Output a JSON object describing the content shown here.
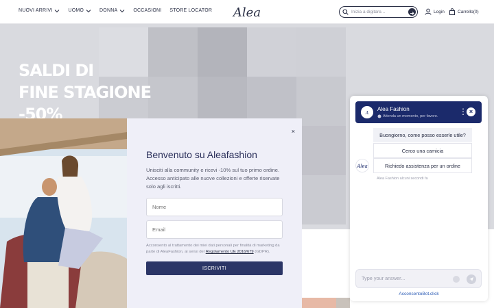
{
  "header": {
    "nav": [
      {
        "label": "NUOVI ARRIVI",
        "has_dropdown": true
      },
      {
        "label": "UOMO",
        "has_dropdown": true
      },
      {
        "label": "DONNA",
        "has_dropdown": true
      },
      {
        "label": "OCCASIONI",
        "has_dropdown": false
      },
      {
        "label": "STORE LOCATOR",
        "has_dropdown": false
      }
    ],
    "logo_text": "Alea",
    "search_placeholder": "Inizia a digitare...",
    "login_label": "Login",
    "cart_label": "Carrello(0)"
  },
  "hero": {
    "line1": "SALDI DI",
    "line2": "FINE STAGIONE",
    "line3": "-50%"
  },
  "modal": {
    "close": "×",
    "title": "Benvenuto su Aleafashion",
    "text": "Unisciti alla community e ricevi -10% sul tuo primo ordine. Accesso anticipato alle nuove collezioni e offerte riservate solo agli iscritti.",
    "name_placeholder": "Nome",
    "email_placeholder": "Email",
    "consent_prefix": "Acconsento al trattamento dei miei dati personali per finalità di marketing da parte di AleaFashion, ai sensi del",
    "consent_link": "Regolamento UE 2016/679",
    "consent_suffix": "(GDPR).",
    "subscribe_label": "ISCRIVITI"
  },
  "chat": {
    "name": "Alea Fashion",
    "status": "Attenda un momento, per favore.",
    "greeting": "Buongiorno, come posso esserle utile?",
    "options": [
      "Cerco una camicia",
      "Richiedo assistenza per un ordine"
    ],
    "timestamp": "Alea Fashion alcuni secondi fa",
    "input_placeholder": "Type your answer...",
    "footer": "AcconsentoBot.click"
  },
  "colors": {
    "navy": "#1b2a6b",
    "button": "#2b3566",
    "modal_bg": "#efeff8"
  }
}
